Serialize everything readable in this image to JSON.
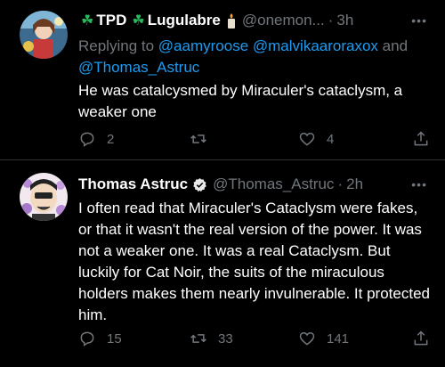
{
  "tweets": [
    {
      "display_name": "TPD",
      "display_name_2": "Lugulabre",
      "name_icon": "candle-emoji",
      "handle": "@onemon...",
      "time": "3h",
      "replying_label": "Replying to",
      "replying_to": [
        "@aamyroose",
        "@malvikaaroraxox"
      ],
      "replying_and": "and",
      "replying_last": "@Thomas_Astruc",
      "text": "He was catalcysmed by Miraculer's cataclysm, a weaker one",
      "reply_count": "2",
      "retweet_count": "",
      "like_count": "4"
    },
    {
      "display_name": "Thomas Astruc",
      "verified": true,
      "handle": "@Thomas_Astruc",
      "time": "2h",
      "text": "I often read that Miraculer's Cataclysm were fakes, or that it wasn't the real version of the power. It was not a weaker one. It was a real Cataclysm. But luckily for Cat Noir, the suits of the miraculous holders makes them nearly invulnerable. It protected him.",
      "reply_count": "15",
      "retweet_count": "33",
      "like_count": "141"
    }
  ],
  "separator_dot": "·",
  "more_label": "•••",
  "colors": {
    "background": "#000000",
    "text": "#ffffff",
    "muted": "#71767b",
    "link": "#1d9bf0",
    "leaf": "#28b95a"
  }
}
